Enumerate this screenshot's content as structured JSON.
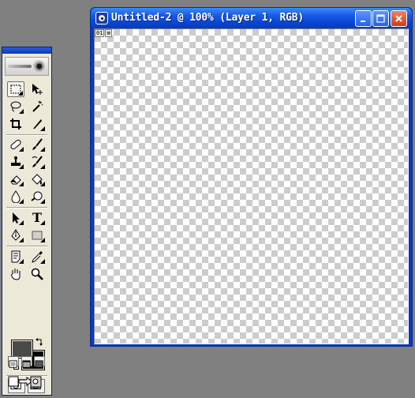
{
  "document_window": {
    "title": "Untitled-2 @ 100% (Layer 1, RGB)",
    "status_labels": [
      "01",
      "⊠"
    ]
  },
  "window_controls": [
    "minimize",
    "maximize",
    "close"
  ],
  "toolbox": {
    "tools": [
      "rectangular-marquee",
      "move",
      "lasso",
      "magic-wand",
      "crop",
      "slice",
      "healing-brush",
      "brush",
      "clone-stamp",
      "history-brush",
      "eraser",
      "paint-bucket",
      "blur",
      "dodge",
      "path-selection",
      "type",
      "pen",
      "rectangle-shape",
      "notes",
      "eyedropper",
      "hand",
      "zoom"
    ],
    "type_tool_glyph": "T",
    "selected_tool": "rectangular-marquee",
    "foreground_color": "#4a4a4a",
    "background_color": "#000000"
  },
  "colors": {
    "workspace": "#808080",
    "titlebar": "#0a3bb8",
    "close_button": "#d03a12"
  }
}
